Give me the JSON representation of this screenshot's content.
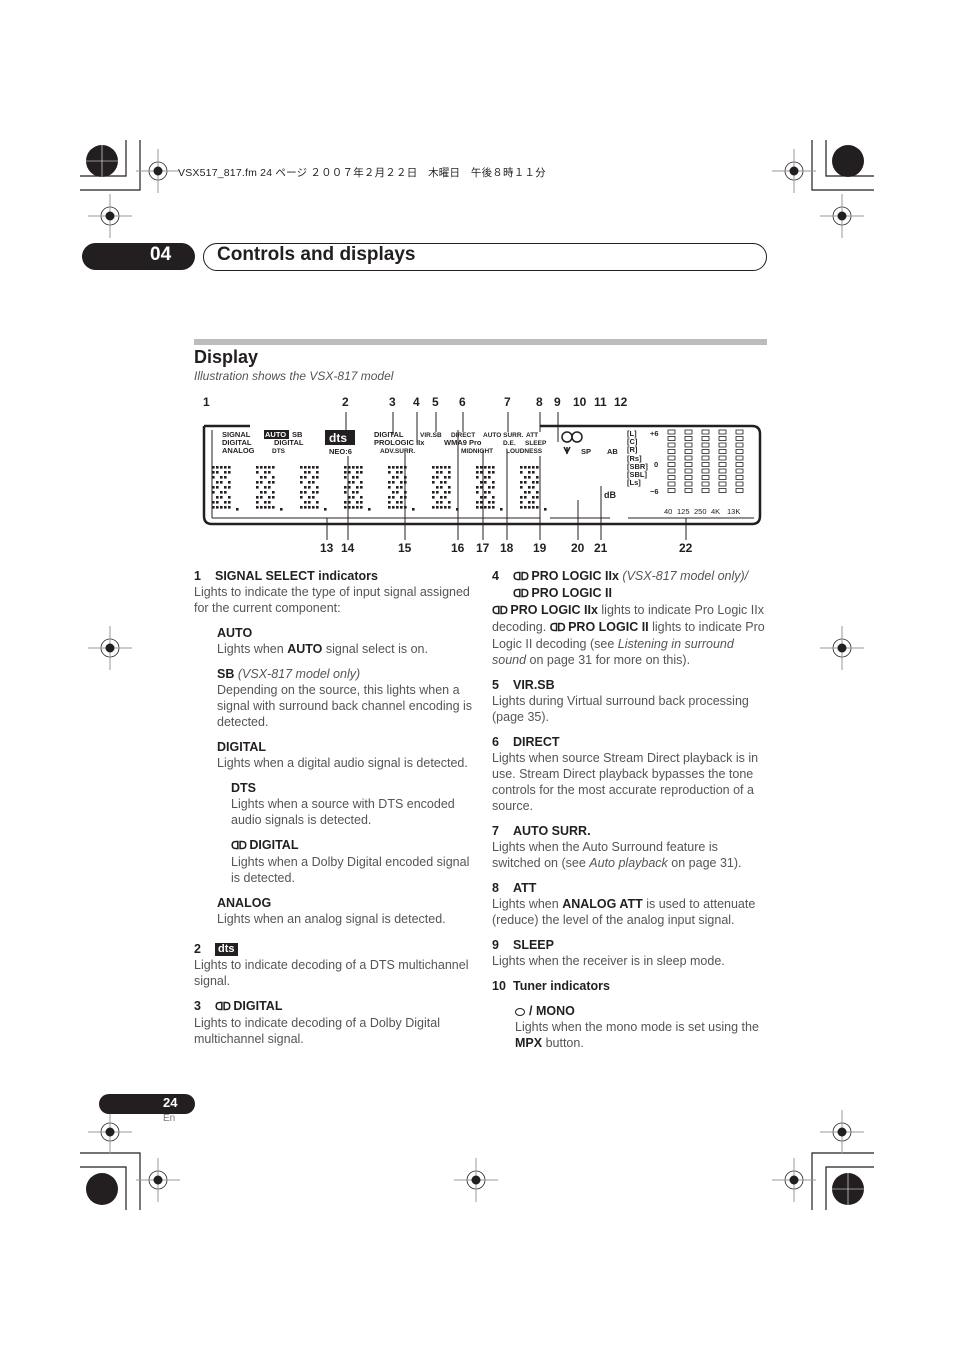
{
  "header_meta": "VSX517_817.fm  24 ページ  ２００７年２月２２日　木曜日　午後８時１１分",
  "chapter": {
    "number": "04",
    "title": "Controls and displays"
  },
  "section": {
    "title": "Display",
    "subtitle": "Illustration shows the VSX-817 model"
  },
  "diagram": {
    "top_callouts": [
      "1",
      "2",
      "3",
      "4",
      "5",
      "6",
      "7",
      "8",
      "9",
      "10",
      "11",
      "12"
    ],
    "bottom_callouts": [
      "13",
      "14",
      "15",
      "16",
      "17",
      "18",
      "19",
      "20",
      "21",
      "22"
    ],
    "indicators": {
      "signal": "SIGNAL",
      "auto": "AUTO",
      "sb": "SB",
      "digital": "DIGITAL",
      "dd_digital": "DIGITAL",
      "analog": "ANALOG",
      "dts": "DTS",
      "dts_logo": "dts",
      "neo6": "NEO:6",
      "dd_digital2": "DIGITAL",
      "prologic": "PROLOGIC IIx",
      "adv_surr": "ADV.SURR.",
      "vir_sb": "VIR.SB",
      "direct": "DIRECT",
      "wma9": "WMA9 Pro",
      "midnight": "MIDNIGHT",
      "auto_surr": "AUTO SURR.",
      "att": "ATT",
      "de": "D.E.",
      "sleep": "SLEEP",
      "loudness": "LOUDNESS",
      "sp": "SP",
      "ab": "AB",
      "db": "dB",
      "channels": [
        "L",
        "C",
        "R",
        "Rs",
        "SBR",
        "SBL",
        "Ls"
      ],
      "level_top": "+6",
      "level_mid": "0",
      "level_bottom": "−6",
      "freq_labels": [
        "40",
        "125",
        "250",
        "4K",
        "13K"
      ]
    }
  },
  "left_column": {
    "item1": {
      "num": "1",
      "title": "SIGNAL SELECT indicators",
      "desc": "Lights to indicate the type of input signal assigned for the current component:"
    },
    "auto": {
      "title": "AUTO",
      "desc_pre": "Lights when ",
      "desc_bold": "AUTO",
      "desc_post": " signal select is on."
    },
    "sb": {
      "title": "SB",
      "note": "(VSX-817 model only)",
      "desc": "Depending on the source, this lights when a signal with surround back channel encoding is detected."
    },
    "digital": {
      "title": "DIGITAL",
      "desc": "Lights when a digital audio signal is detected."
    },
    "dts": {
      "title": "DTS",
      "desc": "Lights when a source with DTS encoded audio signals is detected."
    },
    "dd_digital": {
      "title": "DIGITAL",
      "desc": "Lights when a Dolby Digital encoded signal is detected."
    },
    "analog": {
      "title": "ANALOG",
      "desc": "Lights when an analog signal is detected."
    },
    "item2": {
      "num": "2",
      "logo": "dts",
      "desc": "Lights to indicate decoding of a DTS multichannel signal."
    },
    "item3": {
      "num": "3",
      "title": "DIGITAL",
      "desc": "Lights to indicate decoding of a Dolby Digital multichannel signal."
    }
  },
  "right_column": {
    "item4": {
      "num": "4",
      "title": "PRO LOGIC IIx",
      "note": "(VSX-817 model only)/",
      "title2": "PRO LOGIC II",
      "d1_bold": "PRO LOGIC IIx",
      "d1": " lights to indicate Pro Logic IIx decoding. ",
      "d2_bold": "PRO LOGIC II",
      "d2": " lights to indicate Pro Logic II decoding (see ",
      "d3_italic": "Listening in surround sound",
      "d3": " on page 31 for more on this)."
    },
    "item5": {
      "num": "5",
      "title": "VIR.SB",
      "desc": "Lights during Virtual surround back processing (page 35)."
    },
    "item6": {
      "num": "6",
      "title": "DIRECT",
      "desc": "Lights when source Stream Direct playback is in use. Stream Direct playback bypasses the tone controls for the most accurate reproduction of a source."
    },
    "item7": {
      "num": "7",
      "title": "AUTO SURR.",
      "desc_pre": "Lights when the Auto Surround feature is switched on (see ",
      "desc_italic": "Auto playback",
      "desc_post": " on page 31)."
    },
    "item8": {
      "num": "8",
      "title": "ATT",
      "desc_pre": "Lights when ",
      "desc_bold": "ANALOG ATT",
      "desc_post": " is used to attenuate (reduce) the level of the analog input signal."
    },
    "item9": {
      "num": "9",
      "title": "SLEEP",
      "desc": "Lights when the receiver is in sleep mode."
    },
    "item10": {
      "num": "10",
      "title": "Tuner indicators"
    },
    "mono": {
      "title": "/ MONO",
      "desc_pre": "Lights when the mono mode is set using the ",
      "desc_bold": "MPX",
      "desc_post": " button."
    }
  },
  "footer": {
    "page": "24",
    "lang": "En"
  }
}
